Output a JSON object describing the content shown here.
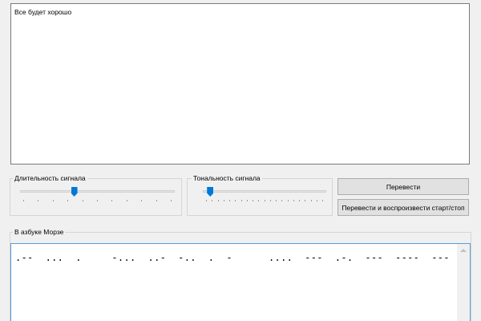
{
  "input": {
    "text": "Все будет хорошо"
  },
  "duration": {
    "label": "Длительность сигнала",
    "level": 0.35,
    "ticks": 10
  },
  "tone": {
    "label": "Тональность сигнала",
    "level": 0.06,
    "ticks": 20
  },
  "buttons": {
    "translate": "Перевести",
    "translate_play": "Перевести и воспроизвести старт/стоп"
  },
  "morse": {
    "label": "В азбуке Морзе",
    "text": ".--  ...  .     -...  ..-  -..  .  -      ....  ---  .-.  ---  ----  ---"
  },
  "colors": {
    "accent": "#0078d7",
    "focus_border": "#5b9bd5"
  }
}
